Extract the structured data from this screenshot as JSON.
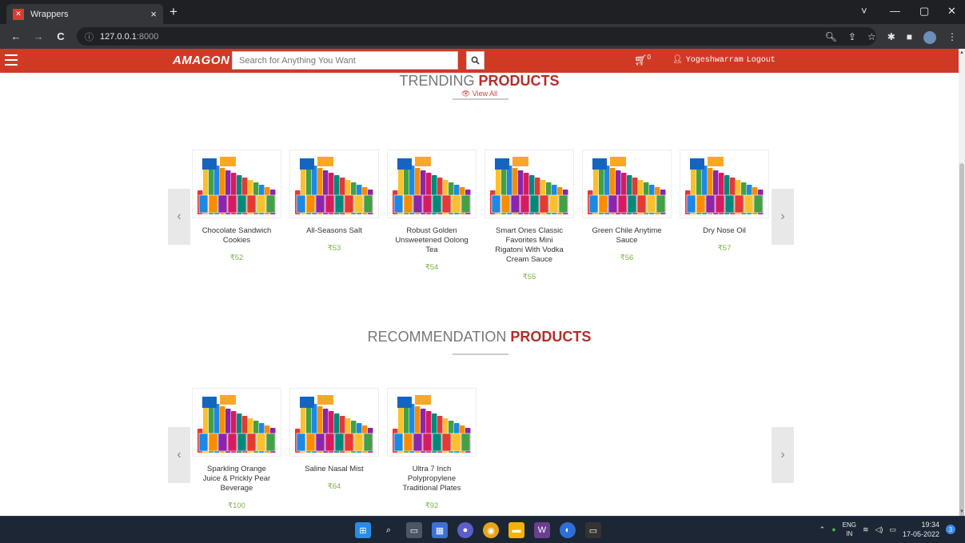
{
  "browser": {
    "tab_title": "Wrappers",
    "tab_close": "×",
    "new_tab": "+",
    "url_host": "127.0.0.1",
    "url_port": ":8000",
    "back": "←",
    "forward": "→",
    "reload": "C",
    "info": "ⓘ",
    "win_down": "˅",
    "win_min": "—",
    "win_max": "▢",
    "win_close": "✕"
  },
  "site": {
    "logo": "AMAGON",
    "search_placeholder": "Search for Anything You Want",
    "cart_count": "0",
    "username": "Yogeshwarram",
    "logout": "Logout"
  },
  "trending": {
    "title_main": "TRENDING ",
    "title_accent": "PRODUCTS",
    "view_all": "👁 View All",
    "products": [
      {
        "name": "Chocolate Sandwich Cookies",
        "price": "₹52"
      },
      {
        "name": "All-Seasons Salt",
        "price": "₹53"
      },
      {
        "name": "Robust Golden Unsweetened Oolong Tea",
        "price": "₹54"
      },
      {
        "name": "Smart Ones Classic Favorites Mini Rigatoni With Vodka Cream Sauce",
        "price": "₹55"
      },
      {
        "name": "Green Chile Anytime Sauce",
        "price": "₹56"
      },
      {
        "name": "Dry Nose Oil",
        "price": "₹57"
      }
    ]
  },
  "recommendation": {
    "title_main": "RECOMMENDATION ",
    "title_accent": "PRODUCTS",
    "products": [
      {
        "name": "Sparkling Orange Juice & Prickly Pear Beverage",
        "price": "₹100"
      },
      {
        "name": "Saline Nasal Mist",
        "price": "₹64"
      },
      {
        "name": "Ultra 7 Inch Polypropylene Traditional Plates",
        "price": "₹92"
      }
    ]
  },
  "carousel": {
    "prev": "‹",
    "next": "›"
  },
  "taskbar": {
    "lang_top": "ENG",
    "lang_bottom": "IN",
    "time": "19:34",
    "date": "17-05-2022",
    "notif": "3"
  },
  "colors": {
    "header_red": "#d03a25",
    "accent_red": "#b0302a",
    "price_green": "#7cb342"
  }
}
